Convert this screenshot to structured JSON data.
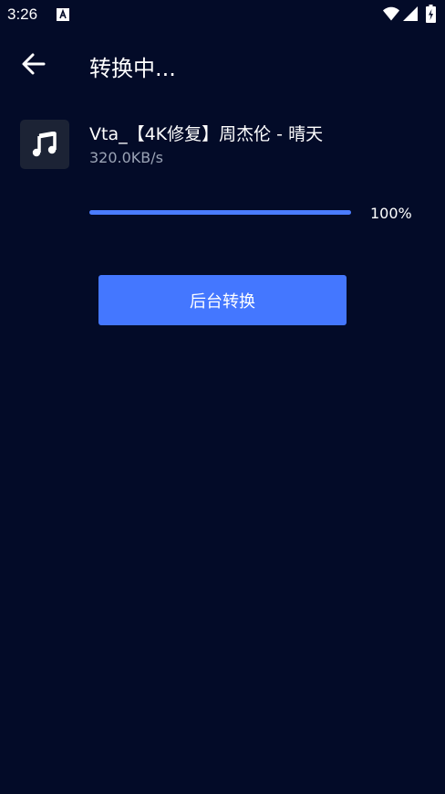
{
  "status_bar": {
    "time": "3:26",
    "icons": [
      "notification-a-icon",
      "wifi-icon",
      "signal-icon",
      "battery-charging-icon"
    ]
  },
  "header": {
    "title": "转换中..."
  },
  "file": {
    "name": "Vta_【4K修复】周杰伦 - 晴天",
    "speed": "320.0KB/s",
    "icon": "music-note-icon"
  },
  "progress": {
    "value": 1.0,
    "label": "100%"
  },
  "actions": {
    "background_convert_label": "后台转换"
  },
  "colors": {
    "background": "#030b28",
    "accent": "#4477ff",
    "progress_fill": "#4a7cff",
    "thumb_bg": "#1c2335",
    "secondary_text": "#9aa3b5"
  }
}
